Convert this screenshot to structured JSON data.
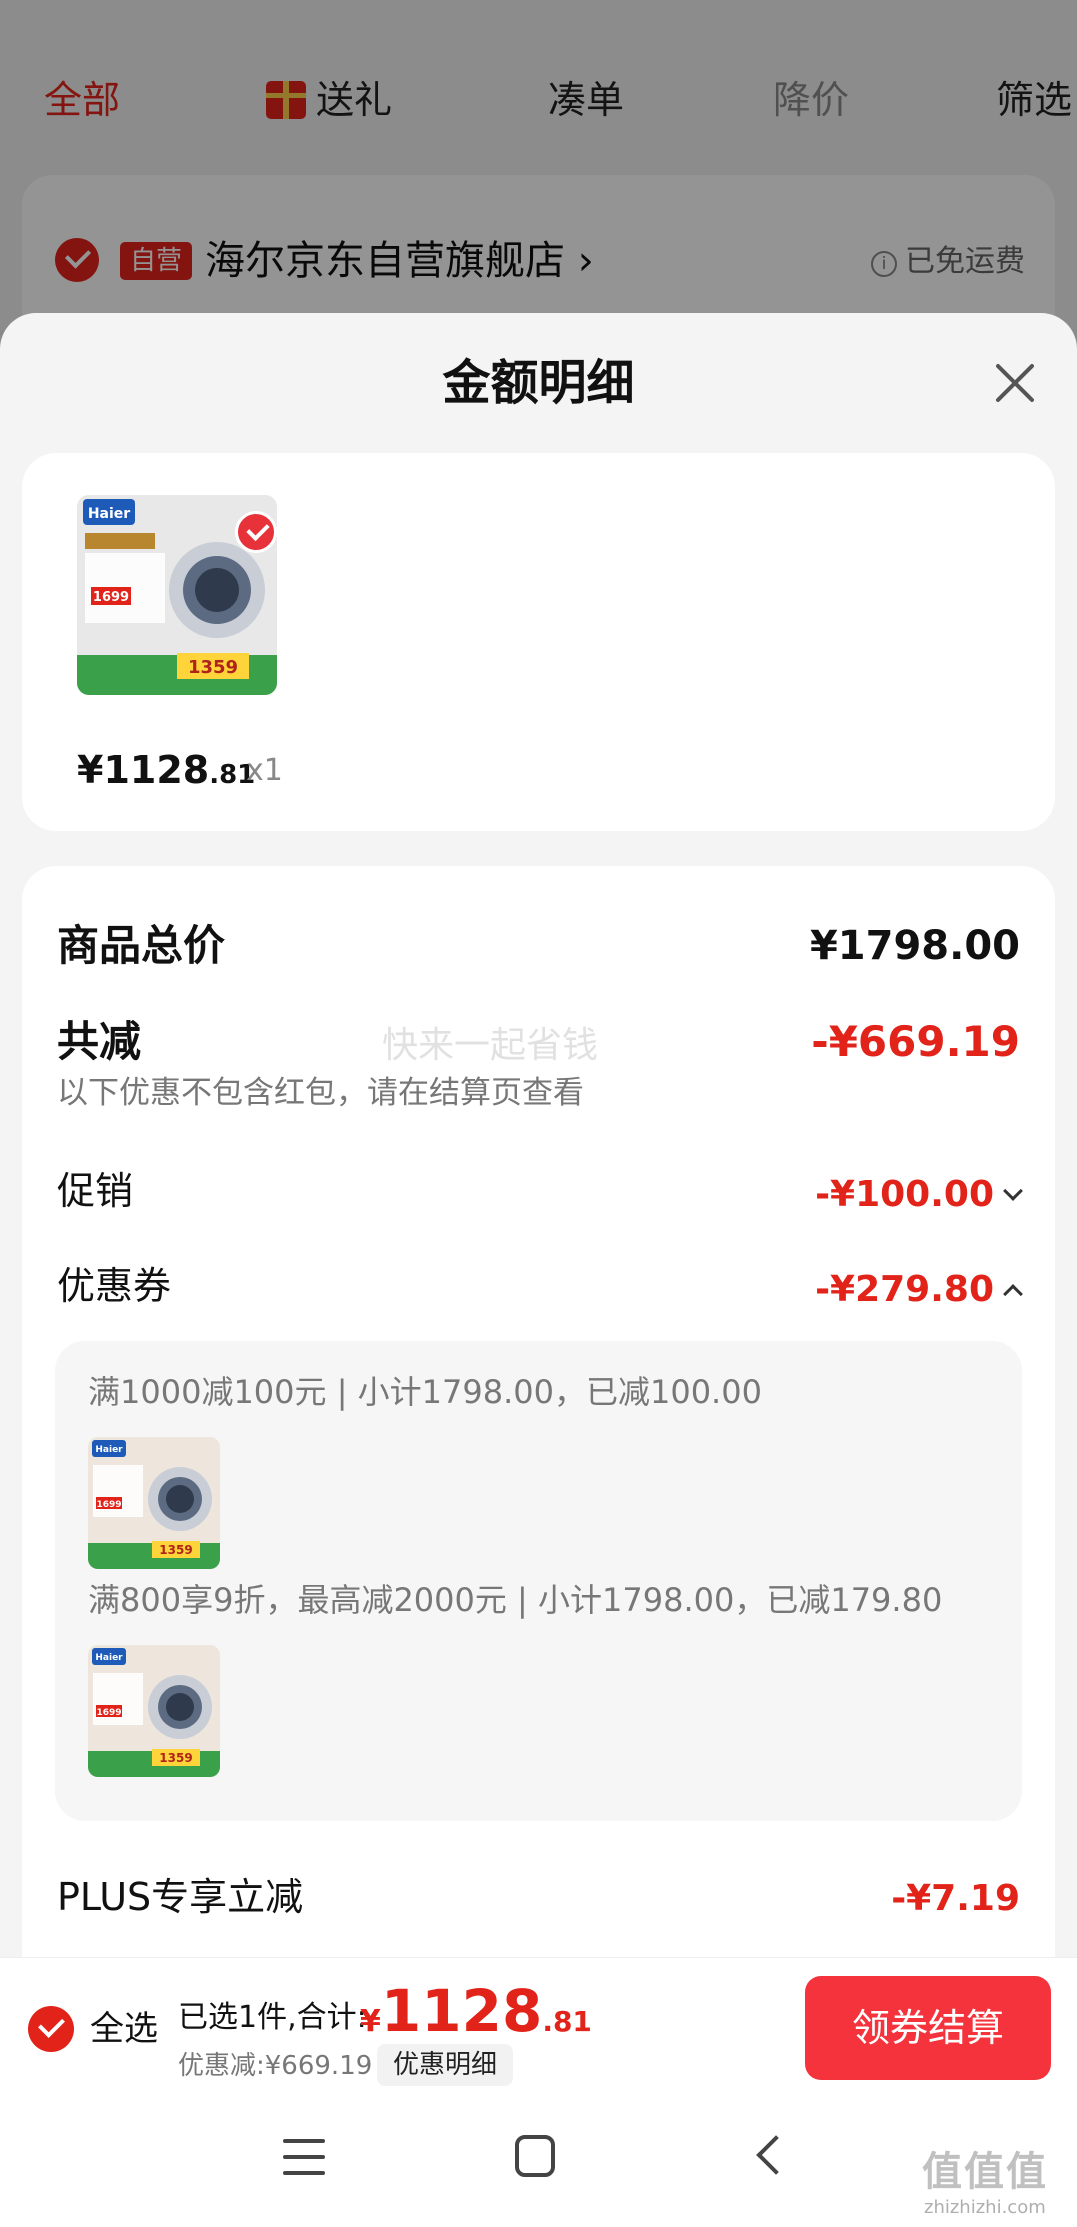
{
  "background": {
    "tabs": [
      {
        "label": "全部"
      },
      {
        "label": "送礼"
      },
      {
        "label": "凑单"
      },
      {
        "label": "降价"
      },
      {
        "label": "筛选"
      }
    ],
    "store": {
      "badge": "自营",
      "name": "海尔京东自营旗舰店",
      "arrow": "›",
      "shipping": "已免运费"
    }
  },
  "sheet": {
    "title": "金额明细",
    "product": {
      "price_main": "¥1128",
      "price_decimal": ".81",
      "quantity": "x1",
      "thumb_text": {
        "brand": "Haier",
        "price_a": "1699",
        "price_b": "1359"
      }
    },
    "details": {
      "total_label": "商品总价",
      "total_value": "¥1798.00",
      "reduce_label": "共减",
      "reduce_value": "-¥669.19",
      "reduce_note": "以下优惠不包含红包，请在结算页查看",
      "watermark": "快来一起省钱",
      "promo_label": "促销",
      "promo_value": "-¥100.00",
      "coupon_label": "优惠券",
      "coupon_value": "-¥279.80",
      "coupons": [
        {
          "text": "满1000减100元 | 小计1798.00，已减100.00"
        },
        {
          "text": "满800享9折，最高减2000元 | 小计1798.00，已减179.80"
        }
      ],
      "plus_label": "PLUS专享立减",
      "plus_value": "-¥7.19"
    }
  },
  "bottom_bar": {
    "select_all": "全选",
    "summary_prefix": "已选1件,合计:",
    "price_yen": "¥",
    "price_int": "1128",
    "price_dec": ".81",
    "discount_text": "优惠减:¥669.19",
    "detail_button": "优惠明细",
    "checkout_button": "领券结算"
  },
  "site_watermark": {
    "mark": "值值值",
    "url": "zhizhizhi.com"
  },
  "colors": {
    "accent": "#e2231a",
    "checkout": "#f4333c",
    "sheet_bg": "#f4f4f4"
  }
}
